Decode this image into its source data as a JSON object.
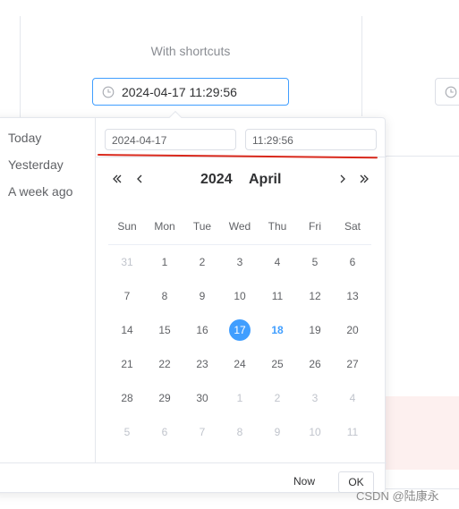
{
  "demo": {
    "label": "With shortcuts",
    "input_value": "2024-04-17 11:29:56"
  },
  "shortcuts": [
    "Today",
    "Yesterday",
    "A week ago"
  ],
  "picker": {
    "date_input": "2024-04-17",
    "time_input": "11:29:56",
    "year": "2024",
    "month": "April",
    "weekdays": [
      "Sun",
      "Mon",
      "Tue",
      "Wed",
      "Thu",
      "Fri",
      "Sat"
    ],
    "weeks": [
      [
        "31",
        "1",
        "2",
        "3",
        "4",
        "5",
        "6"
      ],
      [
        "7",
        "8",
        "9",
        "10",
        "11",
        "12",
        "13"
      ],
      [
        "14",
        "15",
        "16",
        "17",
        "18",
        "19",
        "20"
      ],
      [
        "21",
        "22",
        "23",
        "24",
        "25",
        "26",
        "27"
      ],
      [
        "28",
        "29",
        "30",
        "1",
        "2",
        "3",
        "4"
      ],
      [
        "5",
        "6",
        "7",
        "8",
        "9",
        "10",
        "11"
      ]
    ],
    "selected_day": "17",
    "today_day": "18",
    "now_label": "Now",
    "ok_label": "OK"
  },
  "watermark": "CSDN @陆康永",
  "colors": {
    "accent": "#409eff",
    "annotation_red": "#d9291c"
  },
  "icons": {
    "clock": "clock-icon",
    "prev_year": "double-chevron-left-icon",
    "prev_month": "chevron-left-icon",
    "next_month": "chevron-right-icon",
    "next_year": "double-chevron-right-icon"
  }
}
